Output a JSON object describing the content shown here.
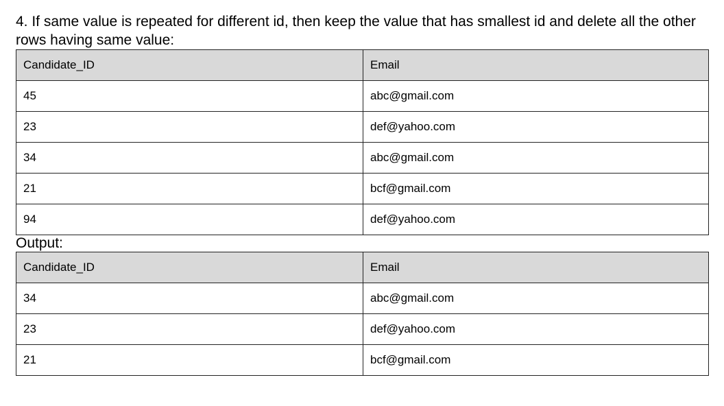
{
  "question": "4. If same value is repeated for different id, then keep the value that has smallest id and delete all the other rows having same value:",
  "input_table": {
    "headers": [
      "Candidate_ID",
      "Email"
    ],
    "rows": [
      [
        "45",
        "abc@gmail.com"
      ],
      [
        "23",
        "def@yahoo.com"
      ],
      [
        "34",
        "abc@gmail.com"
      ],
      [
        "21",
        "bcf@gmail.com"
      ],
      [
        "94",
        "def@yahoo.com"
      ]
    ]
  },
  "output_label": "Output:",
  "output_table": {
    "headers": [
      "Candidate_ID",
      "Email"
    ],
    "rows": [
      [
        "34",
        "abc@gmail.com"
      ],
      [
        "23",
        "def@yahoo.com"
      ],
      [
        "21",
        "bcf@gmail.com"
      ]
    ]
  }
}
